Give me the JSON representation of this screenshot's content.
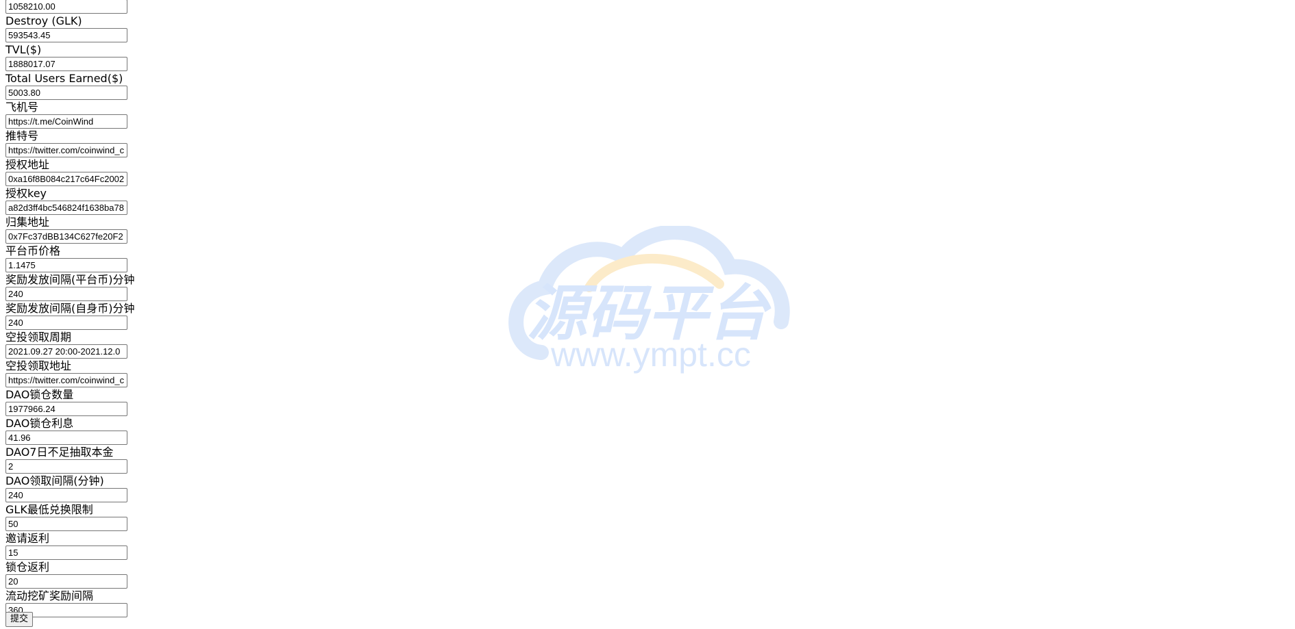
{
  "form": {
    "fields": [
      {
        "label": "",
        "value": "1058210.00"
      },
      {
        "label": "Destroy (GLK)",
        "value": "593543.45"
      },
      {
        "label": "TVL($)",
        "value": "1888017.07"
      },
      {
        "label": "Total Users Earned($)",
        "value": "5003.80"
      },
      {
        "label": "飞机号",
        "value": "https://t.me/CoinWind"
      },
      {
        "label": "推特号",
        "value": "https://twitter.com/coinwind_c"
      },
      {
        "label": "授权地址",
        "value": "0xa16f8B084c217c64Fc2002"
      },
      {
        "label": "授权key",
        "value": "a82d3ff4bc546824f1638ba78"
      },
      {
        "label": "归集地址",
        "value": "0x7Fc37dBB134C627fe20F2"
      },
      {
        "label": "平台币价格",
        "value": "1.1475"
      },
      {
        "label": "奖励发放间隔(平台币)分钟",
        "value": "240"
      },
      {
        "label": "奖励发放间隔(自身币)分钟",
        "value": "240"
      },
      {
        "label": "空投领取周期",
        "value": "2021.09.27 20:00-2021.12.0"
      },
      {
        "label": "空投领取地址",
        "value": "https://twitter.com/coinwind_c"
      },
      {
        "label": "DAO锁仓数量",
        "value": "1977966.24"
      },
      {
        "label": "DAO锁仓利息",
        "value": "41.96"
      },
      {
        "label": "DAO7日不足抽取本金",
        "value": "2"
      },
      {
        "label": "DAO领取间隔(分钟)",
        "value": "240"
      },
      {
        "label": "GLK最低兑换限制",
        "value": "50"
      },
      {
        "label": "邀请返利",
        "value": "15"
      },
      {
        "label": "锁仓返利",
        "value": "20"
      },
      {
        "label": "流动挖矿奖励间隔",
        "value": "360"
      }
    ],
    "submit_label": "提交"
  },
  "watermark": {
    "logo_text": "源码平台",
    "url": "www.ympt.cc",
    "cloud_color": "#dce8fa",
    "accent_color": "#fcebc9",
    "text_color": "#d7e5fb"
  }
}
